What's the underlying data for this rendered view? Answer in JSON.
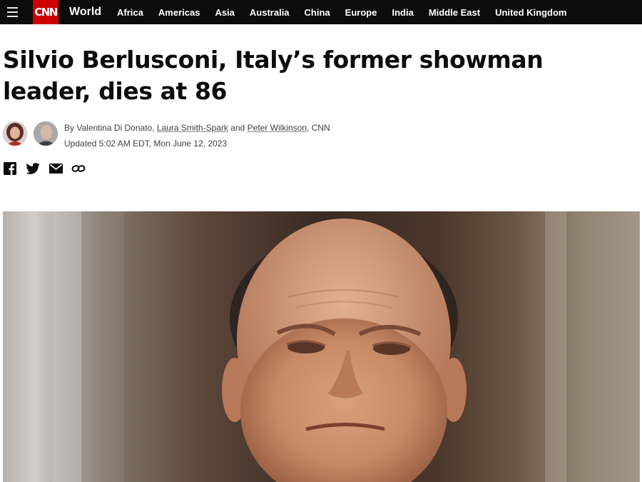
{
  "nav": {
    "menu_icon": "hamburger-menu-icon",
    "logo_text": "CNN",
    "section": "World",
    "links": [
      "Africa",
      "Americas",
      "Asia",
      "Australia",
      "China",
      "Europe",
      "India",
      "Middle East",
      "United Kingdom"
    ]
  },
  "article": {
    "headline": "Silvio Berlusconi, Italy’s former showman leader, dies at 86",
    "byline": {
      "prefix": "By",
      "author1": "Valentina Di Donato",
      "sep1": ",",
      "author2": "Laura Smith-Spark",
      "and": "and",
      "author3": "Peter Wilkinson",
      "suffix": ", CNN"
    },
    "updated": "Updated 5:02 AM EDT, Mon June 12, 2023"
  },
  "share": {
    "icons": [
      "facebook-icon",
      "twitter-icon",
      "email-icon",
      "link-icon"
    ]
  },
  "colors": {
    "brand_red": "#cc0000",
    "nav_bg": "#0c0c0c"
  }
}
